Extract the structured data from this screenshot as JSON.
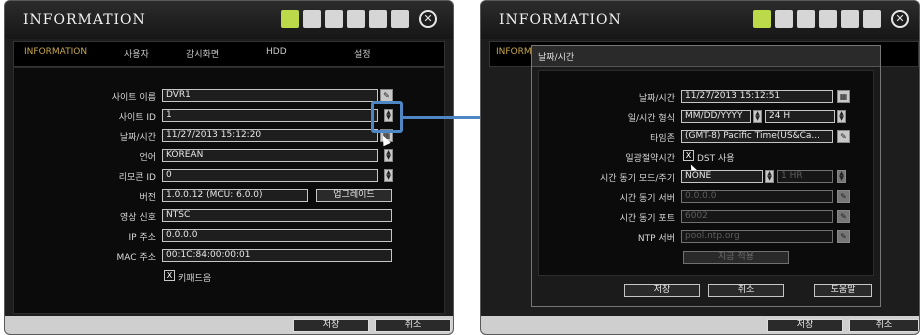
{
  "left": {
    "title": "INFORMATION",
    "tabs": [
      "INFORMATION",
      "사용자",
      "감시화면",
      "HDD",
      "설정"
    ],
    "form": [
      {
        "label": "사이트 이름",
        "value": "DVR1"
      },
      {
        "label": "사이트 ID",
        "value": "1"
      },
      {
        "label": "날짜/시간",
        "value": "11/27/2013 15:12:20"
      },
      {
        "label": "언어",
        "value": "KOREAN"
      },
      {
        "label": "리모콘 ID",
        "value": "0"
      },
      {
        "label": "버전",
        "value": "1.0.0.12 (MCU: 6.0.0)"
      },
      {
        "label": "영상 신호",
        "value": "NTSC"
      },
      {
        "label": "IP 주소",
        "value": "0.0.0.0"
      },
      {
        "label": "MAC 주소",
        "value": "00:1C:84:00:00:01"
      }
    ],
    "upgrade_label": "업그레이드",
    "keypad_check": "X",
    "keypad_label": "키패드음",
    "save_label": "저장",
    "cancel_label": "취소"
  },
  "right": {
    "title": "INFORMATION",
    "tab_partial": "INFORM",
    "dialog_title": "날짜/시간",
    "rows": {
      "datetime_label": "날짜/시간",
      "datetime_value": "11/27/2013 15:12:51",
      "format_label": "일/시간 형식",
      "date_format": "MM/DD/YYYY",
      "time_format": "24 H",
      "tz_label": "타임존",
      "tz_value": "(GMT-8) Pacific Time(US&Ca...",
      "dst_label": "일광절약시간",
      "dst_check": "X",
      "dst_text": "DST 사용",
      "sync_label": "시간 동기 모드/주기",
      "sync_mode": "NONE",
      "sync_period": "1 HR",
      "server_label": "시간 동기 서버",
      "server_value": "0.0.0.0",
      "port_label": "시간 동기 포트",
      "port_value": "6002",
      "ntp_label": "NTP 서버",
      "ntp_value": "pool.ntp.org",
      "apply_label": "지금 적용"
    },
    "save_label": "저장",
    "cancel_label": "취소",
    "help_label": "도움말",
    "outer_save_label": "저장",
    "outer_cancel_label": "취소"
  },
  "colors": {
    "highlight": "#4f86c4",
    "active_tab": "#c8a74a"
  }
}
